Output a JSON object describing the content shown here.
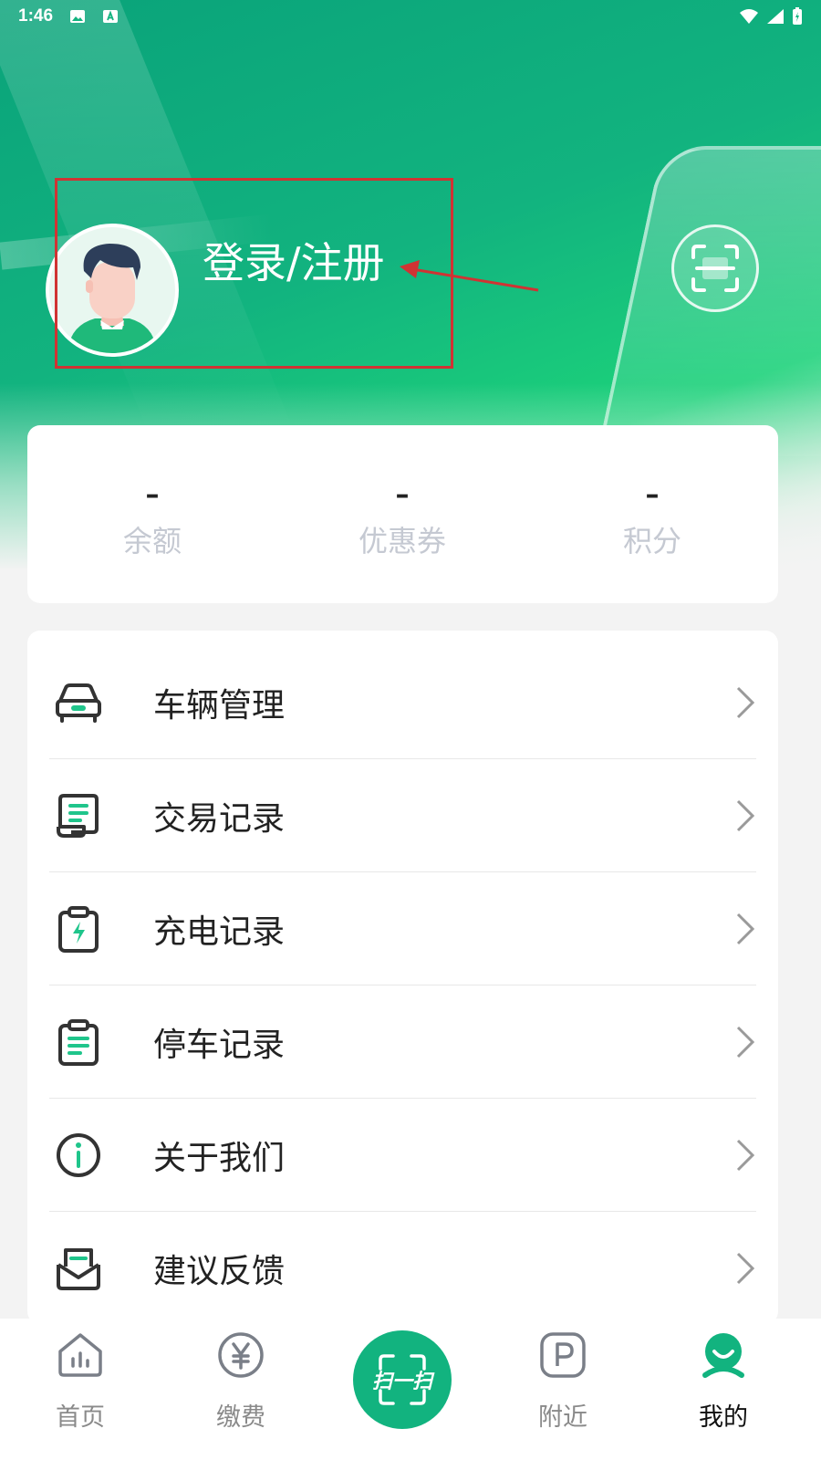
{
  "status_bar": {
    "time": "1:46"
  },
  "profile": {
    "login_label": "登录/注册"
  },
  "stats": [
    {
      "value": "–",
      "label": "余额"
    },
    {
      "value": "–",
      "label": "优惠券"
    },
    {
      "value": "–",
      "label": "积分"
    }
  ],
  "menu": [
    {
      "label": "车辆管理",
      "icon": "car-icon"
    },
    {
      "label": "交易记录",
      "icon": "receipt-icon"
    },
    {
      "label": "充电记录",
      "icon": "charging-clipboard-icon"
    },
    {
      "label": "停车记录",
      "icon": "parking-clipboard-icon"
    },
    {
      "label": "关于我们",
      "icon": "info-icon"
    },
    {
      "label": "建议反馈",
      "icon": "mail-icon"
    }
  ],
  "tabs": [
    {
      "label": "首页",
      "icon": "home-icon"
    },
    {
      "label": "缴费",
      "icon": "yen-coin-icon"
    },
    {
      "label": "扫一扫",
      "icon": "scan-icon"
    },
    {
      "label": "附近",
      "icon": "parking-icon"
    },
    {
      "label": "我的",
      "icon": "profile-icon"
    }
  ],
  "colors": {
    "brand": "#12b37f",
    "annotation": "#d03333",
    "icon_accent": "#1fc58b"
  }
}
